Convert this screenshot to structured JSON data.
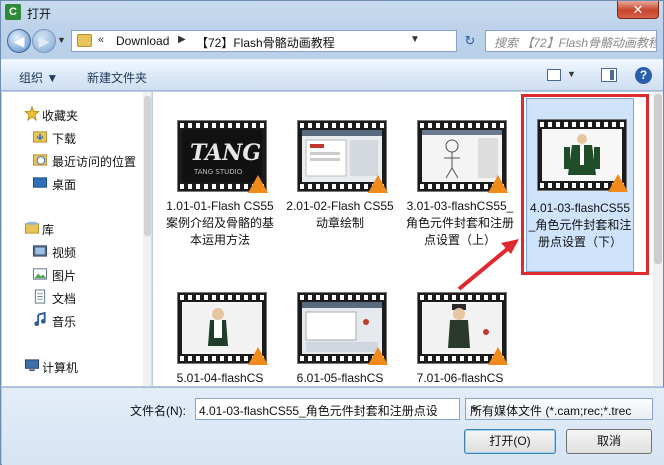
{
  "window": {
    "title": "打开",
    "app_icon_letter": "C",
    "close_label": "✕"
  },
  "nav": {
    "back_label": "◀",
    "forward_label": "▶",
    "breadcrumb_prefix": "«",
    "breadcrumb": [
      "Download",
      "【72】Flash骨骼动画教程"
    ],
    "search_placeholder": "搜索 【72】Flash骨骼动画教程"
  },
  "toolbar": {
    "organize": "组织 ▼",
    "new_folder": "新建文件夹",
    "help": "?"
  },
  "sidebar": {
    "items": [
      {
        "label": "收藏夹",
        "icon": "star-icon",
        "level": 0
      },
      {
        "label": "下载",
        "icon": "download-folder-icon",
        "level": 1
      },
      {
        "label": "最近访问的位置",
        "icon": "recent-places-icon",
        "level": 1
      },
      {
        "label": "桌面",
        "icon": "desktop-icon",
        "level": 1
      },
      {
        "label": "库",
        "icon": "library-icon",
        "level": 0
      },
      {
        "label": "视频",
        "icon": "video-library-icon",
        "level": 1
      },
      {
        "label": "图片",
        "icon": "pictures-library-icon",
        "level": 1
      },
      {
        "label": "文档",
        "icon": "documents-library-icon",
        "level": 1
      },
      {
        "label": "音乐",
        "icon": "music-library-icon",
        "level": 1
      },
      {
        "label": "计算机",
        "icon": "computer-icon",
        "level": 0
      }
    ]
  },
  "files": [
    {
      "label": "1.01-01-Flash CS55 案例介绍及骨骼的基本运用方法",
      "thumb": "tang-studio-logo"
    },
    {
      "label": "2.01-02-Flash CS55 动章绘制",
      "thumb": "flash-ui"
    },
    {
      "label": "3.01-03-flashCS55_角色元件封套和注册点设置（上）",
      "thumb": "sketch-figure"
    },
    {
      "label": "4.01-03-flashCS55_角色元件封套和注册点设置（下）",
      "thumb": "character-green-suit",
      "selected": true
    },
    {
      "label": "5.01-04-flashCS",
      "thumb": "character-white"
    },
    {
      "label": "6.01-05-flashCS",
      "thumb": "flash-timeline"
    },
    {
      "label": "7.01-06-flashCS",
      "thumb": "character-hat"
    }
  ],
  "bottom": {
    "filename_label": "文件名(N):",
    "filename_value": "4.01-03-flashCS55_角色元件封套和注册点设",
    "filetype_value": "所有媒体文件 (*.cam;rec;*.trec",
    "open_button": "打开(O)",
    "cancel_button": "取消"
  },
  "colors": {
    "highlight_red": "#e0282f",
    "selection_blue": "#cfe3fb",
    "vlc_orange": "#f08a1a"
  }
}
